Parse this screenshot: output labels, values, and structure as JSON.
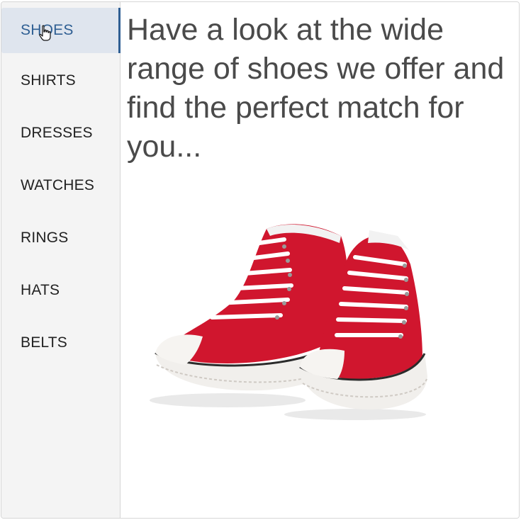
{
  "sidebar": {
    "items": [
      {
        "label": "SHOES",
        "active": true
      },
      {
        "label": "SHIRTS"
      },
      {
        "label": "DRESSES"
      },
      {
        "label": "WATCHES"
      },
      {
        "label": "RINGS"
      },
      {
        "label": "HATS"
      },
      {
        "label": "BELTS"
      }
    ]
  },
  "main": {
    "headline": "Have a look at the wide range of shoes we offer and find the perfect match for you..."
  },
  "colors": {
    "accent": "#2f5f93",
    "active_bg": "#dfe5ee",
    "sidebar_bg": "#f4f4f4",
    "shoe_red": "#d0162e"
  },
  "icons": {
    "cursor": "hand-pointer-icon"
  }
}
